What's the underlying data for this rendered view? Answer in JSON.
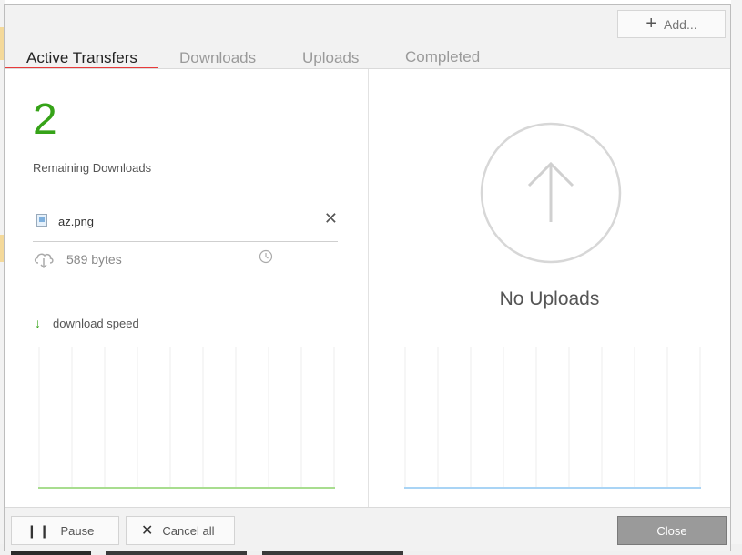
{
  "toolbar": {
    "add_label": "Add..."
  },
  "tabs": [
    {
      "label": "Active Transfers",
      "active": true
    },
    {
      "label": "Downloads",
      "active": false
    },
    {
      "label": "Uploads",
      "active": false
    },
    {
      "label": "Completed",
      "active": false
    }
  ],
  "downloads": {
    "remaining_count": "2",
    "remaining_label": "Remaining Downloads",
    "file": {
      "name": "az.png",
      "size": "589 bytes"
    },
    "speed_label": "download speed"
  },
  "uploads": {
    "empty_label": "No Uploads"
  },
  "footer": {
    "pause_label": "Pause",
    "cancel_label": "Cancel all",
    "close_label": "Close"
  },
  "colors": {
    "accent_red": "#e83a3a",
    "count_green": "#36a318",
    "download_line": "#a8dd8f",
    "upload_line": "#a9d4f5"
  },
  "icons": [
    "plus-icon",
    "image-file-icon",
    "close-icon",
    "cloud-download-icon",
    "clock-icon",
    "arrow-down-icon",
    "arrow-up-icon",
    "pause-icon",
    "x-icon"
  ]
}
